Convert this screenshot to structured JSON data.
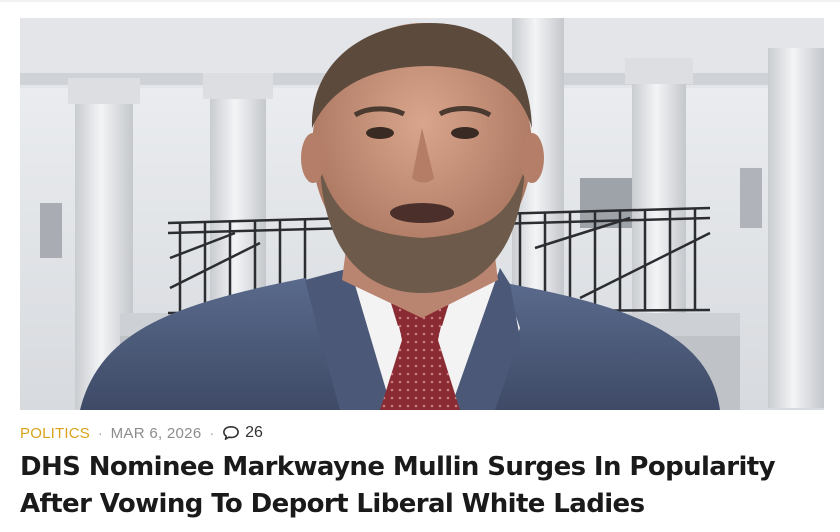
{
  "article": {
    "category": "POLITICS",
    "separator": "·",
    "date": "MAR 6, 2026",
    "comment_count": "26",
    "headline": "DHS Nominee Markwayne Mullin Surges In Popularity After Vowing To Deport Liberal White Ladies"
  },
  "colors": {
    "category": "#d9a21b",
    "meta_text": "#8c8c8c",
    "headline": "#1a1a1a"
  },
  "icons": {
    "comments": "speech-bubble-icon"
  }
}
